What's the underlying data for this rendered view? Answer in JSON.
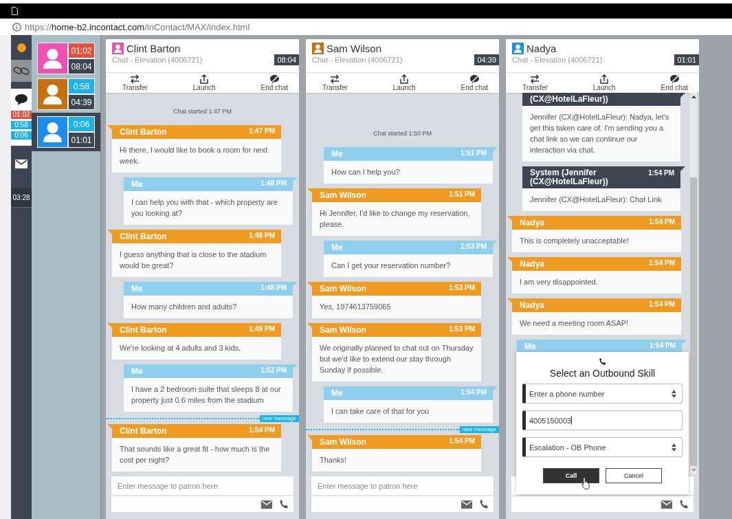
{
  "browser": {
    "scheme": "https://",
    "host": "home-b2.incontact.com",
    "path": "/inContact/MAX/index.html"
  },
  "rail": {
    "chat_timers": [
      {
        "time": "01:02",
        "color": "#e2513f"
      },
      {
        "time": "0:58",
        "color": "#1cb2ec"
      },
      {
        "time": "0:06",
        "color": "#1cb2ec"
      }
    ],
    "email_timer": "03:28"
  },
  "contacts": [
    {
      "color": "#f04fb6",
      "timer": {
        "time": "01:02",
        "color": "#e2513f"
      },
      "total": "08:04",
      "selected": false
    },
    {
      "color": "#c8700e",
      "timer": {
        "time": "0:58",
        "color": "#1cb2ec"
      },
      "total": "04:39",
      "selected": false
    },
    {
      "color": "#1a8ff0",
      "timer": {
        "time": "0:06",
        "color": "#1cb2ec"
      },
      "total": "01:01",
      "selected": true
    }
  ],
  "panels": [
    {
      "name": "Clint Barton",
      "color": "#f04fb6",
      "subtitle": "Chat - Elevation (4006721)",
      "elapsed": "08:04",
      "actions": [
        "Transfer",
        "Launch",
        "End chat"
      ],
      "scrollbar": false,
      "messages": [
        {
          "kind": "notice",
          "text": "Chat started 1:47 PM"
        },
        {
          "kind": "patron",
          "sender": "Clint Barton",
          "time": "1:47 PM",
          "text": "Hi there, I would like to book a room for next week."
        },
        {
          "kind": "agent",
          "sender": "Me",
          "time": "1:48 PM",
          "text": "I can help you with that - which property are you looking at?"
        },
        {
          "kind": "patron",
          "sender": "Clint Barton",
          "time": "1:48 PM",
          "text": "I guess anything that is close to the stadium would be great?"
        },
        {
          "kind": "agent",
          "sender": "Me",
          "time": "1:48 PM",
          "text": "How many children and adults?"
        },
        {
          "kind": "patron",
          "sender": "Clint Barton",
          "time": "1:49 PM",
          "text": "We're looking at 4 adults and 3 kids."
        },
        {
          "kind": "agent",
          "sender": "Me",
          "time": "1:52 PM",
          "text": "I have a 2 bedroom suite that sleeps 8 at our property just 0.6 miles from the stadium"
        },
        {
          "kind": "divider",
          "text": "new message"
        },
        {
          "kind": "patron",
          "sender": "Clint Barton",
          "time": "1:54 PM",
          "text": "That sounds like a great fit - how much is the cost per night?"
        }
      ],
      "placeholder": "Enter message to patron here"
    },
    {
      "name": "Sam Wilson",
      "color": "#c8700e",
      "subtitle": "Chat - Elevation (4006721)",
      "elapsed": "04:39",
      "actions": [
        "Transfer",
        "Launch",
        "End chat"
      ],
      "scrollbar": false,
      "messages": [
        {
          "kind": "notice",
          "text": "Chat started 1:50 PM"
        },
        {
          "kind": "agent",
          "sender": "Me",
          "time": "1:51 PM",
          "text": "How can I help you?"
        },
        {
          "kind": "patron",
          "sender": "Sam Wilson",
          "time": "1:51 PM",
          "text": "Hi Jennifer, I'd like to change my reservation, please."
        },
        {
          "kind": "agent",
          "sender": "Me",
          "time": "1:53 PM",
          "text": "Can I get your reservation number?"
        },
        {
          "kind": "patron",
          "sender": "Sam Wilson",
          "time": "1:53 PM",
          "text": "Yes, 1974613759065"
        },
        {
          "kind": "patron",
          "sender": "Sam Wilson",
          "time": "1:53 PM",
          "text": "We originally planned to chat out on Thursday but we'd like to extend our stay through Sunday if possible."
        },
        {
          "kind": "agent",
          "sender": "Me",
          "time": "1:54 PM",
          "text": "I can take care of that for you"
        },
        {
          "kind": "divider",
          "text": "new message"
        },
        {
          "kind": "patron",
          "sender": "Sam Wilson",
          "time": "1:54 PM",
          "text": "Thanks!"
        }
      ],
      "placeholder": "Enter message to patron here"
    },
    {
      "name": "Nadya",
      "color": "#1a8ff0",
      "subtitle": "Chat - Elevation (4006721)",
      "elapsed": "01:01",
      "actions": [
        "Transfer",
        "Launch",
        "End chat"
      ],
      "scrollbar": true,
      "messages": [
        {
          "kind": "system",
          "sender": "(CX@HotelLaFleur))",
          "text": "Jennifer (CX@HotelLaFleur): Nadya, let's get this taken care of. I'm sending you a chat link so we can continue our interaction via chat."
        },
        {
          "kind": "system",
          "sender": "System (Jennifer (CX@HotelLaFleur))",
          "time": "1:54 PM",
          "text": "Jennifer (CX@HotelLaFleur): Chat Link"
        },
        {
          "kind": "patron",
          "sender": "Nadya",
          "time": "1:54 PM",
          "text": "This is completely unacceptable!"
        },
        {
          "kind": "patron",
          "sender": "Nadya",
          "time": "1:54 PM",
          "text": "I am very disappointed."
        },
        {
          "kind": "patron",
          "sender": "Nadya",
          "time": "1:54 PM",
          "text": "We need a meeting room ASAP!"
        },
        {
          "kind": "agent",
          "sender": "Me",
          "time": "1:54 PM"
        }
      ],
      "dialog": {
        "title": "Select an Outbound Skill",
        "fields": [
          {
            "kind": "select",
            "placeholder": "Enter a phone number"
          },
          {
            "kind": "text",
            "value": "4005150003"
          },
          {
            "kind": "select",
            "value": "Escalation - OB Phone"
          }
        ],
        "buttons": [
          {
            "label": "Call",
            "primary": true
          },
          {
            "label": "Cancel",
            "primary": false
          }
        ]
      }
    }
  ]
}
